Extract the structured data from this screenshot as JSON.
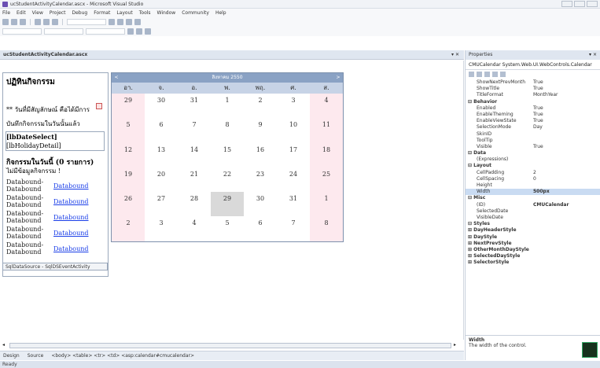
{
  "window": {
    "title": "ucStudentActivityCalendar.ascx - Microsoft Visual Studio"
  },
  "menu": [
    "File",
    "Edit",
    "View",
    "Project",
    "Debug",
    "Format",
    "Layout",
    "Tools",
    "Window",
    "Community",
    "Help"
  ],
  "document_tab": {
    "label": "ucStudentActivityCalendar.ascx",
    "controls": "▾ ✕"
  },
  "left_panel": {
    "title": "ปฏิทินกิจกรรม",
    "bullet_text": "** วันที่มีสัญลักษณ์ คือได้มีการ",
    "note_text": "บันทึกกิจกรรมในวันนั้นแล้ว",
    "date_select": "[lbDateSelect]",
    "holiday_detail": "[lbHolidayDetail]",
    "activities_heading": "กิจกรรมในวันนี้ (0 รายการ)",
    "no_activity": "ไม่มีข้อมูลกิจกรรม !",
    "databound_rows": [
      {
        "line1": "Databound-",
        "line2": "Databound",
        "link": "Databound"
      },
      {
        "line1": "Databound-",
        "line2": "Databound",
        "link": "Databound"
      },
      {
        "line1": "Databound-",
        "line2": "Databound",
        "link": "Databound"
      },
      {
        "line1": "Databound-",
        "line2": "Databound",
        "link": "Databound"
      },
      {
        "line1": "Databound-",
        "line2": "Databound",
        "link": "Databound"
      }
    ],
    "sql_datasource": "SqlDataSource - SqlDSEventActivity"
  },
  "calendar": {
    "title": "สิงหาคม 2550",
    "prev": "<",
    "next": ">",
    "day_headers": [
      "อา.",
      "จ.",
      "อ.",
      "พ.",
      "พฤ.",
      "ศ.",
      "ส."
    ],
    "weeks": [
      [
        "29",
        "30",
        "31",
        "1",
        "2",
        "3",
        "4"
      ],
      [
        "5",
        "6",
        "7",
        "8",
        "9",
        "10",
        "11"
      ],
      [
        "12",
        "13",
        "14",
        "15",
        "16",
        "17",
        "18"
      ],
      [
        "19",
        "20",
        "21",
        "22",
        "23",
        "24",
        "25"
      ],
      [
        "26",
        "27",
        "28",
        "29",
        "30",
        "31",
        "1"
      ],
      [
        "2",
        "3",
        "4",
        "5",
        "6",
        "7",
        "8"
      ]
    ],
    "today": "29",
    "weekend_color": "#fde9ee",
    "header_color": "#8aa2c4"
  },
  "bottom_bar": {
    "design_tab": "Design",
    "source_tab": "Source",
    "breadcrumb": "<body> <table> <tr> <td> <asp:calendar#cmucalendar>"
  },
  "status_bar": {
    "text": "Ready"
  },
  "properties": {
    "title": "Properties",
    "pin": "▾ ×",
    "object": "CMUCalendar  System.Web.UI.WebControls.Calendar",
    "rows": [
      {
        "name": "ShowNextPrevMonth",
        "value": "True",
        "cat": false
      },
      {
        "name": "ShowTitle",
        "value": "True",
        "cat": false
      },
      {
        "name": "TitleFormat",
        "value": "MonthYear",
        "cat": false
      },
      {
        "name": "⊟ Behavior",
        "value": "",
        "cat": true
      },
      {
        "name": "Enabled",
        "value": "True",
        "cat": false
      },
      {
        "name": "EnableTheming",
        "value": "True",
        "cat": false
      },
      {
        "name": "EnableViewState",
        "value": "True",
        "cat": false
      },
      {
        "name": "SelectionMode",
        "value": "Day",
        "cat": false
      },
      {
        "name": "SkinID",
        "value": "",
        "cat": false
      },
      {
        "name": "ToolTip",
        "value": "",
        "cat": false
      },
      {
        "name": "Visible",
        "value": "True",
        "cat": false
      },
      {
        "name": "⊟ Data",
        "value": "",
        "cat": true
      },
      {
        "name": "(Expressions)",
        "value": "",
        "cat": false
      },
      {
        "name": "⊟ Layout",
        "value": "",
        "cat": true
      },
      {
        "name": "CellPadding",
        "value": "2",
        "cat": false
      },
      {
        "name": "CellSpacing",
        "value": "0",
        "cat": false
      },
      {
        "name": "Height",
        "value": "",
        "cat": false
      },
      {
        "name": "Width",
        "value": "500px",
        "cat": false,
        "selected": true,
        "bold": true
      },
      {
        "name": "⊟ Misc",
        "value": "",
        "cat": true
      },
      {
        "name": "(ID)",
        "value": "CMUCalendar",
        "cat": false,
        "bold": true
      },
      {
        "name": "SelectedDate",
        "value": "",
        "cat": false
      },
      {
        "name": "VisibleDate",
        "value": "",
        "cat": false
      },
      {
        "name": "⊟ Styles",
        "value": "",
        "cat": true
      },
      {
        "name": "⊞ DayHeaderStyle",
        "value": "",
        "cat": true
      },
      {
        "name": "⊞ DayStyle",
        "value": "",
        "cat": true
      },
      {
        "name": "⊞ NextPrevStyle",
        "value": "",
        "cat": true
      },
      {
        "name": "⊞ OtherMonthDayStyle",
        "value": "",
        "cat": true
      },
      {
        "name": "⊞ SelectedDayStyle",
        "value": "",
        "cat": true
      },
      {
        "name": "⊞ SelectorStyle",
        "value": "",
        "cat": true
      }
    ],
    "description_title": "Width",
    "description_text": "The width of the control."
  }
}
